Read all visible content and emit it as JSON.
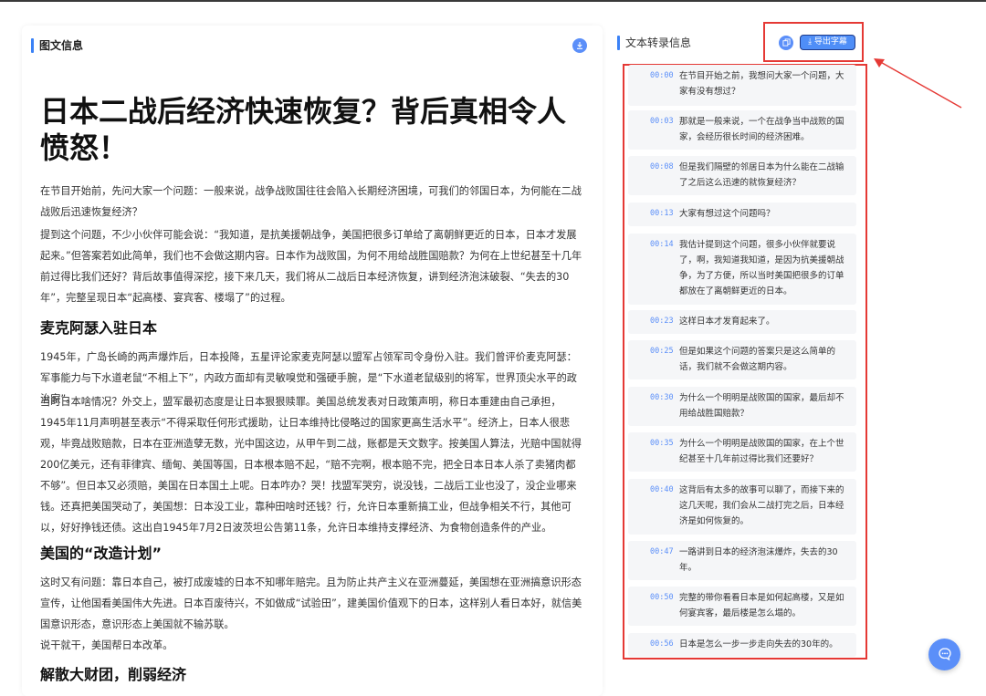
{
  "left_panel": {
    "title": "图文信息",
    "download_icon": "download-icon"
  },
  "article": {
    "title": "日本二战后经济快速恢复？背后真相令人愤怒！",
    "paragraphs": [
      "在节目开始前，先问大家一个问题：一般来说，战争战败国往往会陷入长期经济困境，可我们的邻国日本，为何能在二战战败后迅速恢复经济？",
      "提到这个问题，不少小伙伴可能会说：“我知道，是抗美援朝战争，美国把很多订单给了离朝鲜更近的日本，日本才发展起来。”但答案若如此简单，我们也不会做这期内容。日本作为战败国，为何不用给战胜国赔款？为何在上世纪甚至十几年前过得比我们还好？背后故事值得深挖，接下来几天，我们将从二战后日本经济恢复，讲到经济泡沫破裂、“失去的30年”，完整呈现日本“起高楼、宴宾客、楼塌了”的过程。",
      "1945年，广岛长崎的两声爆炸后，日本投降，五星评论家麦克阿瑟以盟军占领军司令身份入驻。我们曾评价麦克阿瑟：军事能力与下水道老鼠“不相上下”，内政方面却有灵敏嗅觉和强硬手腕，是“下水道老鼠级别的将军，世界顶尖水平的政治家”。",
      "当时日本啥情况？外交上，盟军最初态度是让日本狠狠赎罪。美国总统发表对日政策声明，称日本重建由自己承担，1945年11月声明甚至表示“不得采取任何形式援助，让日本维持比侵略过的国家更高生活水平”。经济上，日本人很悲观，毕竟战败赔款，日本在亚洲造孽无数，光中国这边，从甲午到二战，账都是天文数字。按美国人算法，光赔中国就得200亿美元，还有菲律宾、缅甸、美国等国，日本根本赔不起，“赔不完啊，根本赔不完，把全日本日本人杀了卖猪肉都不够”。但日本又必须赔，美国在日本国土上呢。日本咋办？哭！找盟军哭穷，说没钱，二战后工业也没了，没企业哪来钱。还真把美国哭动了，美国想：日本没工业，靠种田啥时还钱？行，允许日本重新搞工业，但战争相关不行，其他可以，好好挣钱还债。这出自1945年7月2日波茨坦公告第11条，允许日本维持支撑经济、为食物创造条件的产业。",
      "这时又有问题：靠日本自己，被打成废墟的日本不知哪年赔完。且为防止共产主义在亚洲蔓延，美国想在亚洲搞意识形态宣传，让他国看美国伟大先进。日本百废待兴，不如做成“试验田”，建美国价值观下的日本，这样别人看日本好，就信美国意识形态，意识形态上美国就不输苏联。",
      "说干就干，美国帮日本改革。"
    ],
    "headings": [
      "麦克阿瑟入驻日本",
      "美国的“改造计划”",
      "解散大财团，削弱经济"
    ]
  },
  "transcript": {
    "title": "文本转录信息",
    "copy_icon": "copy-icon",
    "export_label": "导出字幕",
    "entries": [
      {
        "time": "00:00",
        "text": "在节目开始之前，我想问大家一个问题，大家有没有想过？"
      },
      {
        "time": "00:03",
        "text": "那就是一般来说，一个在战争当中战败的国家，会经历很长时间的经济困难。"
      },
      {
        "time": "00:08",
        "text": "但是我们隔壁的邻居日本为什么能在二战输了之后这么迅速的就恢复经济？"
      },
      {
        "time": "00:13",
        "text": "大家有想过这个问题吗？"
      },
      {
        "time": "00:14",
        "text": "我估计提到这个问题，很多小伙伴就要说了，啊，我知道我知道，是因为抗美援朝战争，为了方便，所以当时美国把很多的订单都放在了离朝鲜更近的日本。"
      },
      {
        "time": "00:23",
        "text": "这样日本才发育起来了。"
      },
      {
        "time": "00:25",
        "text": "但是如果这个问题的答案只是这么简单的话，我们就不会做这期内容。"
      },
      {
        "time": "00:30",
        "text": "为什么一个明明是战败国的国家，最后却不用给战胜国赔款？"
      },
      {
        "time": "00:35",
        "text": "为什么一个明明是战败国的国家，在上个世纪甚至十几年前过得比我们还要好？"
      },
      {
        "time": "00:40",
        "text": "这背后有太多的故事可以聊了，而接下来的这几天呢，我们会从二战打完之后，日本经济是如何恢复的。"
      },
      {
        "time": "00:47",
        "text": "一路讲到日本的经济泡沫爆炸，失去的30年。"
      },
      {
        "time": "00:50",
        "text": "完整的带你看看日本是如何起高楼，又是如何宴宾客，最后楼是怎么塌的。"
      },
      {
        "time": "00:56",
        "text": "日本是怎么一步一步走向失去的30年的。"
      }
    ]
  },
  "chat_icon": "chat-icon",
  "colors": {
    "accent": "#5b8ff9",
    "highlight": "#e53935"
  }
}
